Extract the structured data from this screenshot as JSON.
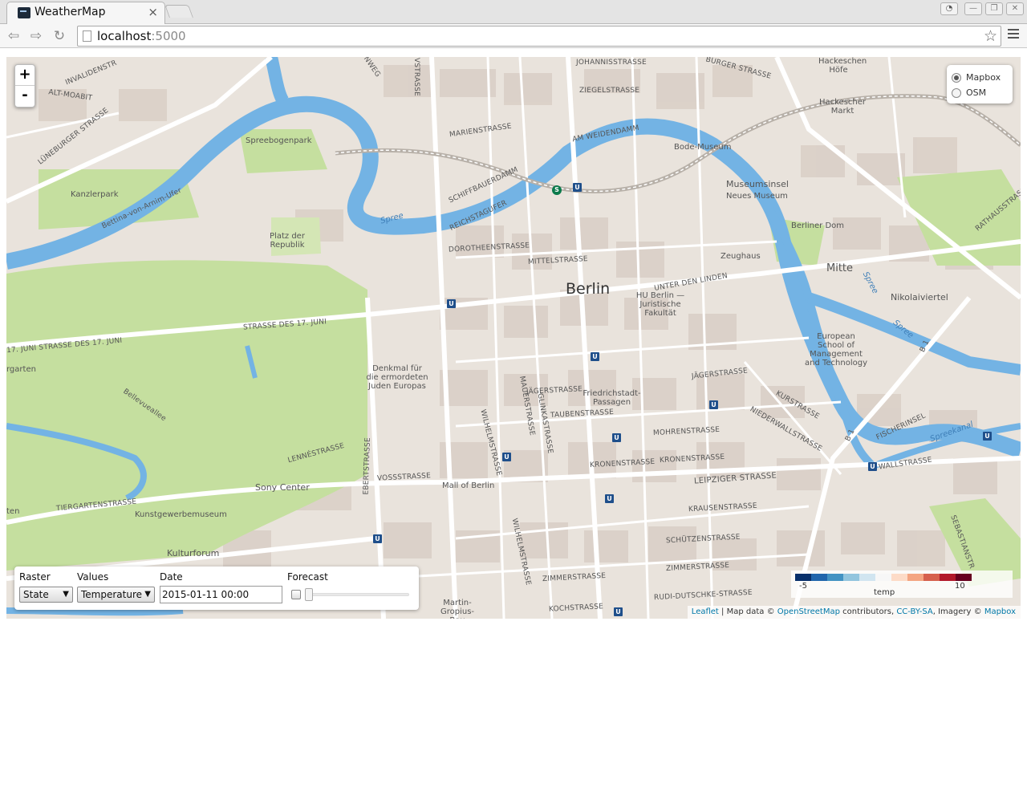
{
  "browser": {
    "tab_title": "WeatherMap",
    "tab_close": "×",
    "url_host": "localhost",
    "url_port": ":5000",
    "star": "☆",
    "back": "⇦",
    "forward": "⇨",
    "reload": "↻"
  },
  "map": {
    "zoom_in": "+",
    "zoom_out": "-",
    "layers": [
      "Mapbox",
      "OSM"
    ],
    "selected_layer": "Mapbox",
    "labels": {
      "berlin": "Berlin",
      "mitte": "Mitte",
      "invalidenstr": "INVALIDENSTR",
      "alt_moabit": "ALT-MOABIT",
      "luneburger": "LÜNEBURGER STRASSE",
      "kanzlerpark": "Kanzlerpark",
      "bettina": "Bettina-von-Arnim-Ufer",
      "spreebogenpark": "Spreebogenpark",
      "platz_der_republik": "Platz der Republik",
      "spree1": "Spree",
      "spree2": "Spree",
      "spree3": "Spree",
      "spreekanal": "Spreekanal",
      "johannisstrasse": "JOHANNISSTRASSE",
      "ziegelstrasse": "ZIEGELSTRASSE",
      "burger": "BURGER STRASSE",
      "hackeschen_hofe": "Hackeschen Höfe",
      "hackescher_markt": "Hackescher Markt",
      "marienstrasse": "MARIENSTRASSE",
      "am_weidendamm": "AM WEIDENDAMM",
      "bode_museum": "Bode-Museum",
      "schiffbauerdamm": "SCHIFFBAUERDAMM",
      "reichstagufer": "REICHSTAGUFER",
      "museumsinsel": "Museumsinsel",
      "neues_museum": "Neues Museum",
      "berliner_dom": "Berliner Dom",
      "dorotheenstrasse": "DOROTHEENSTRASSE",
      "mittelstrasse": "MITTELSTRASSE",
      "zeughaus": "Zeughaus",
      "unter_den_linden": "UNTER DEN LINDEN",
      "hu_berlin": "HU Berlin — Juristische Fakultät",
      "nikolaiviertel": "Nikolaiviertel",
      "strasse_17_juni_1": "STRASSE DES 17. JUNI",
      "strasse_17_juni_2": "17. JUNI  STRASSE DES 17. JUNI",
      "garten": "rgarten",
      "esmt": "European School of Management and Technology",
      "denkmal": "Denkmal für die ermordeten Juden Europas",
      "jagerstrasse1": "JÄGERSTRASSE",
      "jagerstrasse2": "JÄGERSTRASSE",
      "friedrichstadt": "Friedrichstadt-Passagen",
      "taubenstrasse": "TAUBENSTRASSE",
      "mauerstrasse": "MAUERSTRASSE",
      "glinkastrasse": "GLINKASTRASSE",
      "wilhelmstrasse1": "WILHELMSTRASSE",
      "wilhelmstrasse2": "WILHELMSTRASSE",
      "kurstrasse": "KURSTRASSE",
      "niederwallstrasse": "NIEDERWALLSTRASSE",
      "fischerinsel": "FISCHERINSEL",
      "rathausstrasse": "RATHAUSSTRASSE",
      "bellevueallee": "Bellevueallee",
      "lennestrasse": "LENNÉSTRASSE",
      "ebertstrasse": "EBERTSTRASSE",
      "vossstrasse": "VOSSSTRASSE",
      "mall_of_berlin": "Mall of Berlin",
      "mohrenstrasse": "MOHRENSTRASSE",
      "kronenstrasse1": "KRONENSTRASSE",
      "kronenstrasse2": "KRONENSTRASSE",
      "leipziger": "LEIPZIGER STRASSE",
      "wallstrasse": "WALLSTRASSE",
      "sony_center": "Sony Center",
      "tiergartenstrasse": "TIERGARTENSTRASSE",
      "kunstgewerbemuseum": "Kunstgewerbemuseum",
      "krausenstrasse": "KRAUSENSTRASSE",
      "schutzenstrasse": "SCHÜTZENSTRASSE",
      "kulturforum": "Kulturforum",
      "zimmerstrasse1": "ZIMMERSTRASSE",
      "zimmerstrasse2": "ZIMMERSTRASSE",
      "rudi_dutschke": "RUDI-DUTSCHKE-STRASSE",
      "kochstrasse": "KOCHSTRASSE",
      "martin_gropius": "Martin-Gropius-Bau",
      "ten": "ten",
      "sebastianstr": "SEBASTIANSTR",
      "b1a": "B 1",
      "b1b": "B 1",
      "vstrasse": "VSTRASSE",
      "nweg": "NWEG"
    },
    "u_badge": "U",
    "s_badge": "S"
  },
  "controls": {
    "raster_label": "Raster",
    "raster_value": "State",
    "values_label": "Values",
    "values_value": "Temperature",
    "date_label": "Date",
    "date_value": "2015-01-11 00:00",
    "forecast_label": "Forecast",
    "forecast_checked": false,
    "forecast_position": 0,
    "dropdown_arrow": "▼"
  },
  "legend": {
    "min": "-5",
    "max": "10",
    "label": "temp",
    "colors": [
      "#08306b",
      "#2166ac",
      "#4393c3",
      "#92c5de",
      "#d1e5f0",
      "#f7f7f7",
      "#fddbc7",
      "#f4a582",
      "#d6604d",
      "#b2182b",
      "#67001f"
    ]
  },
  "attribution": {
    "leaflet": "Leaflet",
    "sep1": " | Map data © ",
    "osm": "OpenStreetMap",
    "contributors": " contributors, ",
    "ccbysa": "CC-BY-SA",
    "imagery": ", Imagery © ",
    "mapbox": "Mapbox"
  }
}
